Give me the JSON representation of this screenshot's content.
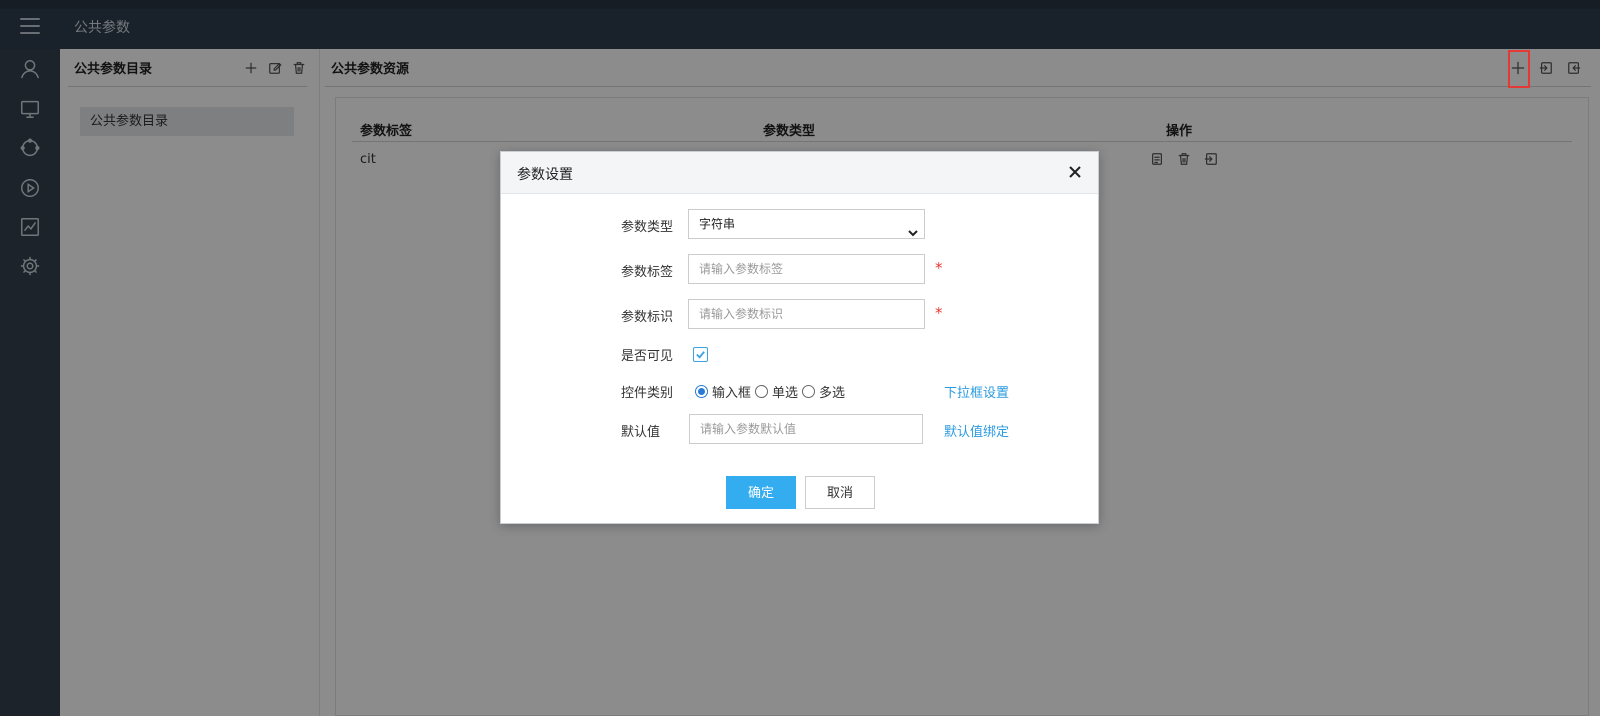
{
  "topbar": {
    "title": "公共参数"
  },
  "sidebar": {
    "icons": [
      "user-icon",
      "monitor-icon",
      "cycle-icon",
      "play-icon",
      "chart-icon",
      "settings-icon"
    ]
  },
  "left_panel": {
    "title": "公共参数目录",
    "actions": [
      "add-icon",
      "edit-icon",
      "delete-icon"
    ],
    "tree_items": [
      "公共参数目录"
    ]
  },
  "right_panel": {
    "title": "公共参数资源",
    "actions": [
      "add-icon",
      "import-icon",
      "export-icon"
    ],
    "columns": [
      "参数标签",
      "参数类型",
      "操作"
    ],
    "rows": [
      {
        "label": "cit",
        "actions": [
          "detail-icon",
          "delete-icon",
          "import-icon"
        ]
      }
    ]
  },
  "modal": {
    "title": "参数设置",
    "fields": {
      "type": {
        "label": "参数类型",
        "value": "字符串"
      },
      "label": {
        "label": "参数标签",
        "placeholder": "请输入参数标签",
        "required": "*"
      },
      "identifier": {
        "label": "参数标识",
        "placeholder": "请输入参数标识",
        "required": "*"
      },
      "visible": {
        "label": "是否可见",
        "checked": true
      },
      "control_type": {
        "label": "控件类别",
        "options": [
          "输入框",
          "单选",
          "多选"
        ],
        "selected": "输入框",
        "link": "下拉框设置"
      },
      "default": {
        "label": "默认值",
        "placeholder": "请输入参数默认值",
        "link": "默认值绑定"
      }
    },
    "buttons": {
      "ok": "确定",
      "cancel": "取消"
    }
  },
  "colors": {
    "accent": "#33adf0",
    "link": "#2b9be0",
    "required": "#e53935",
    "topbar": "#2f3e4e",
    "sidebar": "#34414e"
  }
}
